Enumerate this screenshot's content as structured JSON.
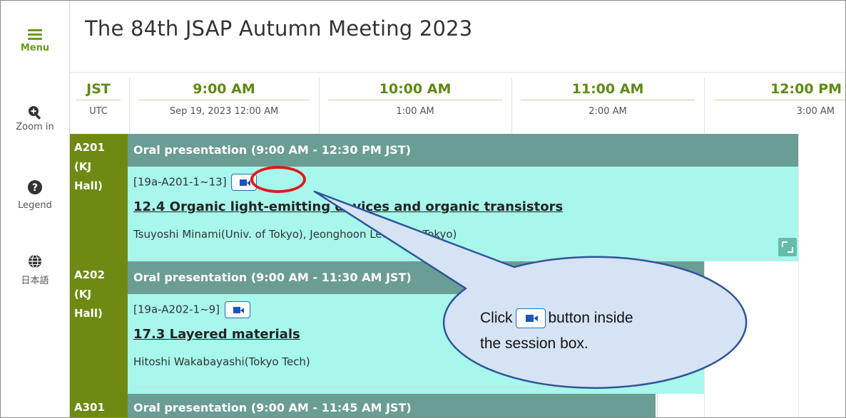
{
  "sidebar": {
    "menu_label": "Menu",
    "zoom_label": "Zoom in",
    "legend_label": "Legend",
    "language_label": "日本語"
  },
  "header": {
    "title": "The 84th JSAP Autumn Meeting 2023"
  },
  "timeline": {
    "tz_primary": "JST",
    "tz_secondary": "UTC",
    "columns": [
      {
        "jst": "9:00 AM",
        "utc": "Sep 19, 2023 12:00 AM"
      },
      {
        "jst": "10:00 AM",
        "utc": "1:00 AM"
      },
      {
        "jst": "11:00 AM",
        "utc": "2:00 AM"
      },
      {
        "jst": "12:00 PM",
        "utc": "3:00 AM"
      }
    ]
  },
  "sessions": [
    {
      "room_line1": "A201",
      "room_line2": "(KJ",
      "room_line3": "Hall)",
      "header": "Oral presentation  (9:00 AM - 12:30 PM JST)",
      "code": "[19a-A201-1~13]",
      "title": "12.4 Organic light-emitting devices and organic transistors",
      "authors": "Tsuyoshi Minami(Univ. of Tokyo), Jeonghoon Lee(Univ. Tokyo)"
    },
    {
      "room_line1": "A202",
      "room_line2": "(KJ",
      "room_line3": "Hall)",
      "header": "Oral presentation  (9:00 AM - 11:30 AM JST)",
      "code": "[19a-A202-1~9]",
      "title": "17.3 Layered materials",
      "authors": "Hitoshi Wakabayashi(Tokyo Tech)"
    },
    {
      "room_line1": "A301",
      "header": "Oral presentation  (9:00 AM - 11:45 AM JST)"
    }
  ],
  "callout": {
    "prefix": "Click",
    "suffix": "button inside",
    "line2": "the session box."
  },
  "colors": {
    "accent_green": "#6a9a1d",
    "room_bg": "#6e8a13",
    "session_header": "#6a9d94",
    "session_body": "#a7f7ec",
    "callout_fill": "#d6e3f5",
    "callout_stroke": "#2f5597",
    "highlight_ring": "#e01919"
  },
  "icons": {
    "menu": "hamburger-icon",
    "zoom": "zoom-in-icon",
    "legend": "help-icon",
    "language": "globe-icon",
    "video": "video-camera-icon",
    "expand": "expand-icon"
  }
}
